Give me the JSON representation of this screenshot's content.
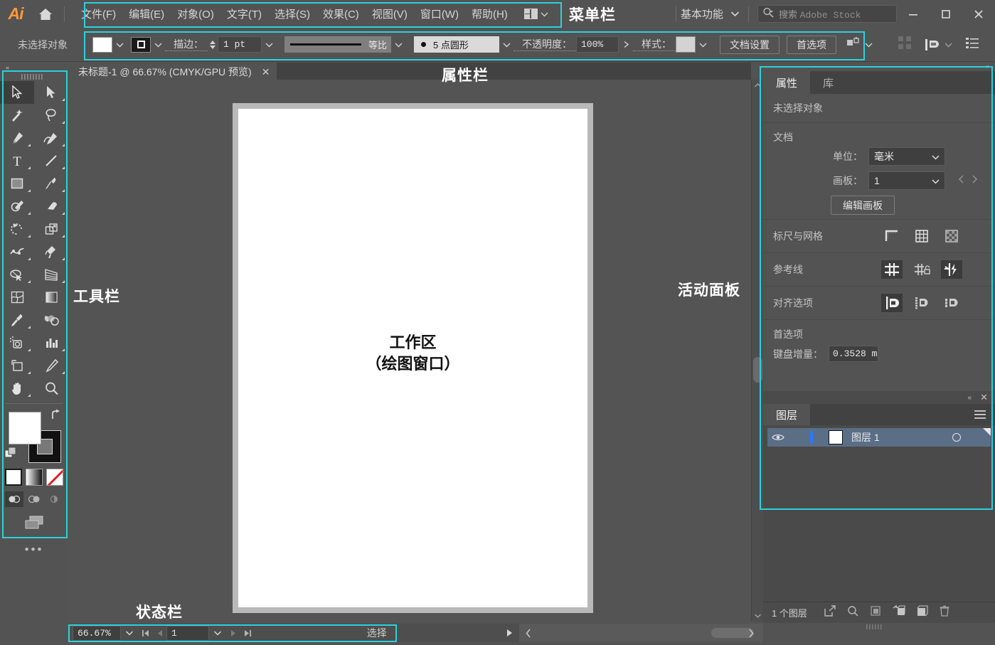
{
  "app": {
    "logo_text": "Ai",
    "workspace_name": "基本功能",
    "search_placeholder_prefix": "搜索",
    "search_placeholder_suffix": "Adobe Stock"
  },
  "menubar": {
    "items": [
      {
        "label": "文件(F)"
      },
      {
        "label": "编辑(E)"
      },
      {
        "label": "对象(O)"
      },
      {
        "label": "文字(T)"
      },
      {
        "label": "选择(S)"
      },
      {
        "label": "效果(C)"
      },
      {
        "label": "视图(V)"
      },
      {
        "label": "窗口(W)"
      },
      {
        "label": "帮助(H)"
      }
    ]
  },
  "window_buttons": {
    "minimize": "—",
    "maximize": "□",
    "close": "✕"
  },
  "controlbar": {
    "no_selection": "未选择对象",
    "stroke_label": "描边：",
    "stroke_weight": "1 pt",
    "stroke_profile": "等比",
    "brush_definition": "5 点圆形",
    "opacity_label": "不透明度：",
    "opacity_value": "100%",
    "style_label": "样式：",
    "document_setup": "文档设置",
    "preferences": "首选项"
  },
  "document_tab": {
    "title": "未标题-1 @ 66.67% (CMYK/GPU 预览)",
    "close": "✕"
  },
  "canvas": {
    "workspace_line1": "工作区",
    "workspace_line2": "（绘图窗口）"
  },
  "properties_panel": {
    "tabs": [
      {
        "label": "属性",
        "active": true
      },
      {
        "label": "库",
        "active": false
      }
    ],
    "no_selection": "未选择对象",
    "document_section": "文档",
    "unit_label": "单位：",
    "unit_value": "毫米",
    "artboard_label": "画板：",
    "artboard_value": "1",
    "edit_artboard_button": "编辑画板",
    "rulers_grid_label": "标尺与网格",
    "guides_label": "参考线",
    "align_label": "对齐选项",
    "preferences_section": "首选项",
    "keyboard_increment_label": "键盘增量：",
    "keyboard_increment_value": "0.3528 m"
  },
  "layers_panel": {
    "tab_label": "图层",
    "layer_name": "图层 1",
    "footer_count": "1 个图层"
  },
  "statusbar": {
    "zoom": "66.67%",
    "page": "1",
    "status_text": "选择"
  },
  "annotations": [
    {
      "key": "menubar",
      "label": "菜单栏"
    },
    {
      "key": "controlbar",
      "label": "属性栏"
    },
    {
      "key": "toolbar",
      "label": "工具栏"
    },
    {
      "key": "panels",
      "label": "活动面板"
    },
    {
      "key": "statusbar",
      "label": "状态栏"
    }
  ],
  "colors": {
    "highlight": "#29d2dd",
    "panel_bg": "#535353",
    "accent_orange": "#ff9a3c",
    "layer_selected": "#5a6e86"
  },
  "tools": [
    {
      "name": "selection-tool",
      "active": true
    },
    {
      "name": "direct-selection-tool",
      "active": false
    },
    {
      "name": "magic-wand-tool",
      "active": false
    },
    {
      "name": "lasso-tool",
      "active": false
    },
    {
      "name": "pen-tool",
      "active": false
    },
    {
      "name": "curvature-tool",
      "active": false
    },
    {
      "name": "type-tool",
      "active": false
    },
    {
      "name": "line-segment-tool",
      "active": false
    },
    {
      "name": "rectangle-tool",
      "active": false
    },
    {
      "name": "paintbrush-tool",
      "active": false
    },
    {
      "name": "shaper-tool",
      "active": false
    },
    {
      "name": "eraser-tool",
      "active": false
    },
    {
      "name": "rotate-tool",
      "active": false
    },
    {
      "name": "scale-tool",
      "active": false
    },
    {
      "name": "width-tool",
      "active": false
    },
    {
      "name": "free-transform-tool",
      "active": false
    },
    {
      "name": "shape-builder-tool",
      "active": false
    },
    {
      "name": "perspective-grid-tool",
      "active": false
    },
    {
      "name": "mesh-tool",
      "active": false
    },
    {
      "name": "gradient-tool",
      "active": false
    },
    {
      "name": "eyedropper-tool",
      "active": false
    },
    {
      "name": "blend-tool",
      "active": false
    },
    {
      "name": "symbol-sprayer-tool",
      "active": false
    },
    {
      "name": "column-graph-tool",
      "active": false
    },
    {
      "name": "artboard-tool",
      "active": false
    },
    {
      "name": "slice-tool",
      "active": false
    },
    {
      "name": "hand-tool",
      "active": false
    },
    {
      "name": "zoom-tool",
      "active": false
    }
  ]
}
